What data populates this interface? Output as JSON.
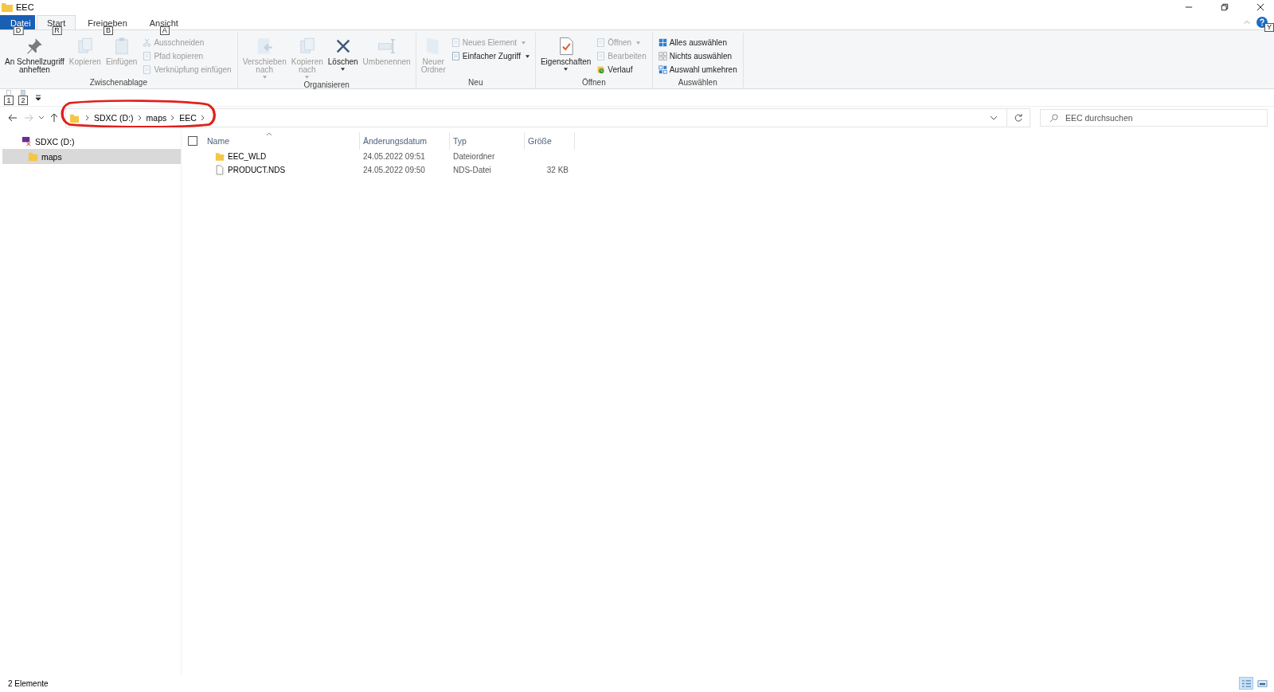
{
  "window": {
    "title": "EEC"
  },
  "ribbon_tabs": [
    {
      "label": "Datei",
      "keytip": "D",
      "kind": "file",
      "selected": false
    },
    {
      "label": "Start",
      "keytip": "R",
      "kind": "tab",
      "selected": true
    },
    {
      "label": "Freigeben",
      "keytip": "B",
      "kind": "tab",
      "selected": false
    },
    {
      "label": "Ansicht",
      "keytip": "A",
      "kind": "tab",
      "selected": false
    }
  ],
  "help_keytip": "Y",
  "ribbon_groups": [
    {
      "name": "Zwischenablage",
      "items": [
        {
          "kind": "large",
          "lines": [
            "An Schnellzugriff",
            "anheften"
          ],
          "disabled": false,
          "dropdown": false
        },
        {
          "kind": "large",
          "lines": [
            "Kopieren"
          ],
          "disabled": true,
          "dropdown": false
        },
        {
          "kind": "large",
          "lines": [
            "Einfügen"
          ],
          "disabled": true,
          "dropdown": false
        },
        {
          "kind": "small",
          "label": "Ausschneiden",
          "disabled": true,
          "dropdown": false
        },
        {
          "kind": "small",
          "label": "Pfad kopieren",
          "disabled": true,
          "dropdown": false
        },
        {
          "kind": "small",
          "label": "Verknüpfung einfügen",
          "disabled": true,
          "dropdown": false
        }
      ]
    },
    {
      "name": "Organisieren",
      "items": [
        {
          "kind": "large",
          "lines": [
            "Verschieben",
            "nach"
          ],
          "disabled": true,
          "dropdown": true
        },
        {
          "kind": "large",
          "lines": [
            "Kopieren",
            "nach"
          ],
          "disabled": true,
          "dropdown": true
        },
        {
          "kind": "large",
          "lines": [
            "Löschen"
          ],
          "disabled": false,
          "dropdown": true
        },
        {
          "kind": "large",
          "lines": [
            "Umbenennen"
          ],
          "disabled": true,
          "dropdown": false
        }
      ]
    },
    {
      "name": "Neu",
      "items": [
        {
          "kind": "large",
          "lines": [
            "Neuer",
            "Ordner"
          ],
          "disabled": true,
          "dropdown": false
        },
        {
          "kind": "small",
          "label": "Neues Element",
          "disabled": true,
          "dropdown": true
        },
        {
          "kind": "small",
          "label": "Einfacher Zugriff",
          "disabled": false,
          "dropdown": true
        }
      ]
    },
    {
      "name": "Öffnen",
      "items": [
        {
          "kind": "large",
          "lines": [
            "Eigenschaften"
          ],
          "disabled": false,
          "dropdown": true
        },
        {
          "kind": "small",
          "label": "Öffnen",
          "disabled": true,
          "dropdown": true
        },
        {
          "kind": "small",
          "label": "Bearbeiten",
          "disabled": true,
          "dropdown": false
        },
        {
          "kind": "small",
          "label": "Verlauf",
          "disabled": false,
          "dropdown": false
        }
      ]
    },
    {
      "name": "Auswählen",
      "items": [
        {
          "kind": "small",
          "label": "Alles auswählen",
          "disabled": false,
          "dropdown": false
        },
        {
          "kind": "small",
          "label": "Nichts auswählen",
          "disabled": false,
          "dropdown": false
        },
        {
          "kind": "small",
          "label": "Auswahl umkehren",
          "disabled": false,
          "dropdown": false
        }
      ]
    }
  ],
  "quick_access": [
    {
      "keytip": "1"
    },
    {
      "keytip": "2"
    }
  ],
  "address_bar": {
    "path": [
      "SDXC (D:)",
      "maps",
      "EEC"
    ]
  },
  "search": {
    "placeholder": "EEC durchsuchen"
  },
  "navigation": [
    {
      "label": "SDXC (D:)",
      "kind": "drive",
      "selected": false,
      "children": [
        {
          "label": "maps",
          "kind": "folder",
          "selected": true
        }
      ]
    }
  ],
  "table": {
    "select_all": {
      "checked": false
    },
    "columns": [
      "Name",
      "Änderungsdatum",
      "Typ",
      "Größe"
    ],
    "rows": [
      {
        "kind": "folder",
        "name": "EEC_WLD",
        "date": "24.05.2022 09:51",
        "type": "Dateiordner",
        "size": null
      },
      {
        "kind": "file",
        "name": "PRODUCT.NDS",
        "date": "24.05.2022 09:50",
        "type": "NDS-Datei",
        "size": "32 KB"
      }
    ]
  },
  "status_bar": {
    "count": "2 Elemente",
    "views": [
      {
        "kind": "details",
        "selected": true
      },
      {
        "kind": "tiles",
        "selected": false
      }
    ]
  }
}
